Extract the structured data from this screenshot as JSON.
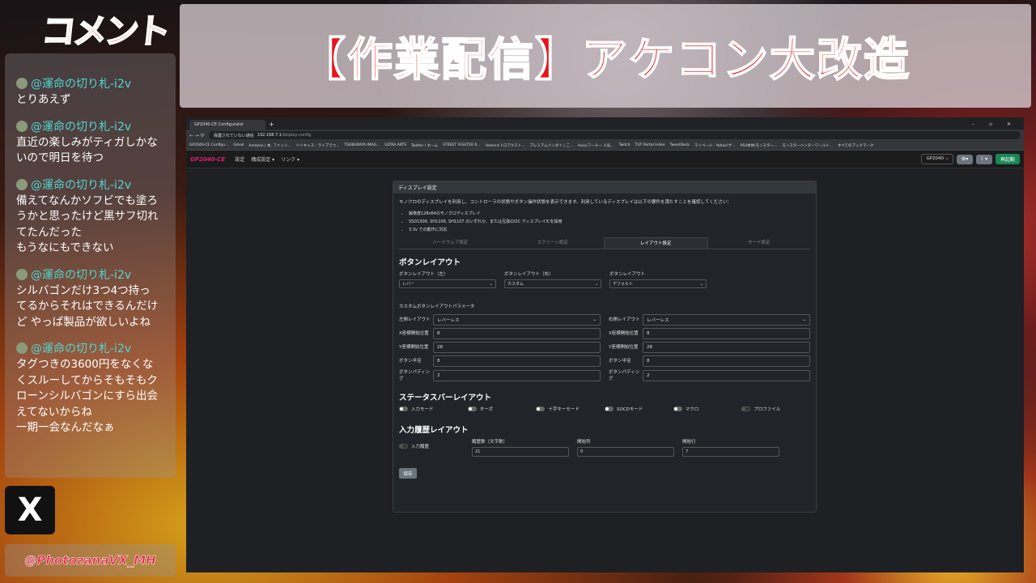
{
  "stream": {
    "logo_text": "コメント",
    "title": "【作業配信】アケコン大改造",
    "handle": "@PhotozanaVX_MH",
    "x_logo": "X"
  },
  "chat": [
    {
      "user": "@運命の切り札-i2v",
      "text": "とりあえず"
    },
    {
      "user": "@運命の切り札-i2v",
      "text": "直近の楽しみがティガしかな\nいので明日を待つ"
    },
    {
      "user": "@運命の切り札-i2v",
      "text": "備えてなんかソフビでも塗ろ\nうかと思ったけど黒サフ切れ\nてたんだった\nもうなにもできない"
    },
    {
      "user": "@運命の切り札-i2v",
      "text": "シルバゴンだけ3つ4つ持っ\nてるからそれはできるんだけ\nど やっぱ製品が欲しいよね"
    },
    {
      "user": "@運命の切り札-i2v",
      "text": "タグつきの3600円をなくな\nくスルーしてからそもそもク\nローンシルバゴンにすら出会\nえてないからね\n一期一会なんだなぁ"
    }
  ],
  "browser": {
    "tab_title": "GP2040-CE Configurator",
    "tab_plus": "+",
    "win_controls": "– ▫ ✕",
    "nav": "← → ⟳",
    "security": "保護されていない通信",
    "url_host": "192.168.7.1",
    "url_path": "/display-config",
    "bookmarks": [
      "GP2040-CE Configu...",
      "Gmail",
      "Amazon | 本, ファッシ...",
      "ツイキャス - ライブでつ...",
      "TSUBURAYA IMAG...",
      "ULTRA ARTS",
      "Twitter / ホーム",
      "STREET FIGHTER 6...",
      "Homeメトロアクスト...",
      "プレミアムバンダイ | ご...",
      "Hulu/フールー 人気...",
      "Twitch",
      "TUT Portal Index",
      "TweetDeck",
      "マイページ - Yahoo!ゲ...",
      "PS4本体/モンスター...",
      "モンスターハンターワールド...",
      "すべてのブックマーク"
    ]
  },
  "app": {
    "brand": "GP2040-CE",
    "nav": [
      "設定",
      "構成設定 ▾",
      "リンク ▾"
    ],
    "board": "GP2040 ⌵",
    "gear": "⚙▾",
    "moon": "☾▾",
    "reboot": "再起動"
  },
  "card": {
    "header": "ディスプレイ設定",
    "intro": "モノクロのディスプレイを利用し、コントローラの状態やボタン操作状態を表示できます。利用しているディスプレイは以下の要件を満たすことを確認してください：",
    "requirements": [
      "解像度128x64のモノクロディスプレイ",
      "SSD1306, SH1106, SH1107 のいずれか、または互換のI2C ディスプレイICを採用",
      "3.3v での動作に対応"
    ],
    "tabs": [
      "ハードウェア設定",
      "スクリーン設定",
      "レイアウト設定",
      "モード設定"
    ],
    "button_layout": {
      "title": "ボタンレイアウト",
      "cols": [
        {
          "label": "ボタンレイアウト（左）",
          "value": "レバー"
        },
        {
          "label": "ボタンレイアウト（右）",
          "value": "カスタム"
        },
        {
          "label": "ボタンレイアウト",
          "value": "デフォルト"
        }
      ]
    },
    "custom": {
      "title": "カスタムボタンレイアウトパラメータ",
      "left": [
        {
          "label": "左側レイアウト",
          "value": "レバーレス",
          "select": true
        },
        {
          "label": "X座標開始位置",
          "value": "8"
        },
        {
          "label": "Y座標開始位置",
          "value": "28"
        },
        {
          "label": "ボタン半径",
          "value": "8"
        },
        {
          "label": "ボタンパディング",
          "value": "2"
        }
      ],
      "right": [
        {
          "label": "右側レイアウト",
          "value": "レバーレス",
          "select": true
        },
        {
          "label": "X座標開始位置",
          "value": "8"
        },
        {
          "label": "Y座標開始位置",
          "value": "28"
        },
        {
          "label": "ボタン半径",
          "value": "8"
        },
        {
          "label": "ボタンパディング",
          "value": "2"
        }
      ]
    },
    "statusbar": {
      "title": "ステータスバーレイアウト",
      "toggles": [
        {
          "label": "入力モード",
          "on": true
        },
        {
          "label": "ターボ",
          "on": true
        },
        {
          "label": "十字キーモード",
          "on": true
        },
        {
          "label": "SOCDモード",
          "on": true
        },
        {
          "label": "マクロ",
          "on": true
        },
        {
          "label": "プロファイル",
          "on": false
        }
      ]
    },
    "history": {
      "title": "入力履歴レイアウト",
      "checkbox": "入力履歴",
      "fields": [
        {
          "label": "履歴数（文字数）",
          "value": "21"
        },
        {
          "label": "開始列",
          "value": "0"
        },
        {
          "label": "開始行",
          "value": "7"
        }
      ]
    },
    "save": "保存"
  }
}
